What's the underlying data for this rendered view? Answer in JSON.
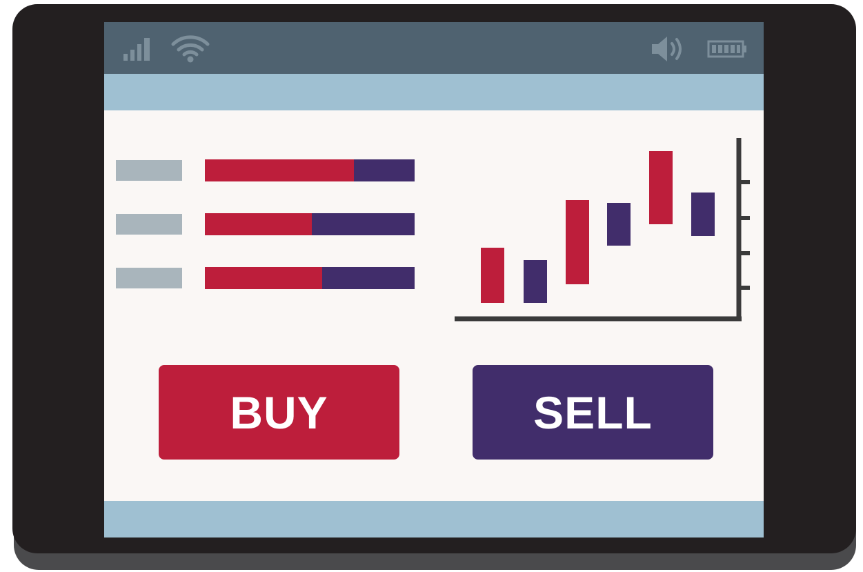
{
  "colors": {
    "frame": "#231f20",
    "frame_shadow": "#4a4a4c",
    "status_bar": "#4f6270",
    "status_icons": "#7d8f9b",
    "band": "#9fc0d2",
    "screen": "#faf7f5",
    "label_placeholder": "#a9b5bc",
    "buy": "#bd1e3b",
    "sell": "#412d6b",
    "axis": "#3a3a3a"
  },
  "status_bar": {
    "icons": [
      "signal-icon",
      "wifi-icon",
      "volume-icon",
      "battery-icon"
    ]
  },
  "order_book": {
    "rows": [
      {
        "buy_share": 0.71
      },
      {
        "buy_share": 0.51
      },
      {
        "buy_share": 0.56
      }
    ]
  },
  "buttons": {
    "buy_label": "BUY",
    "sell_label": "SELL"
  }
}
